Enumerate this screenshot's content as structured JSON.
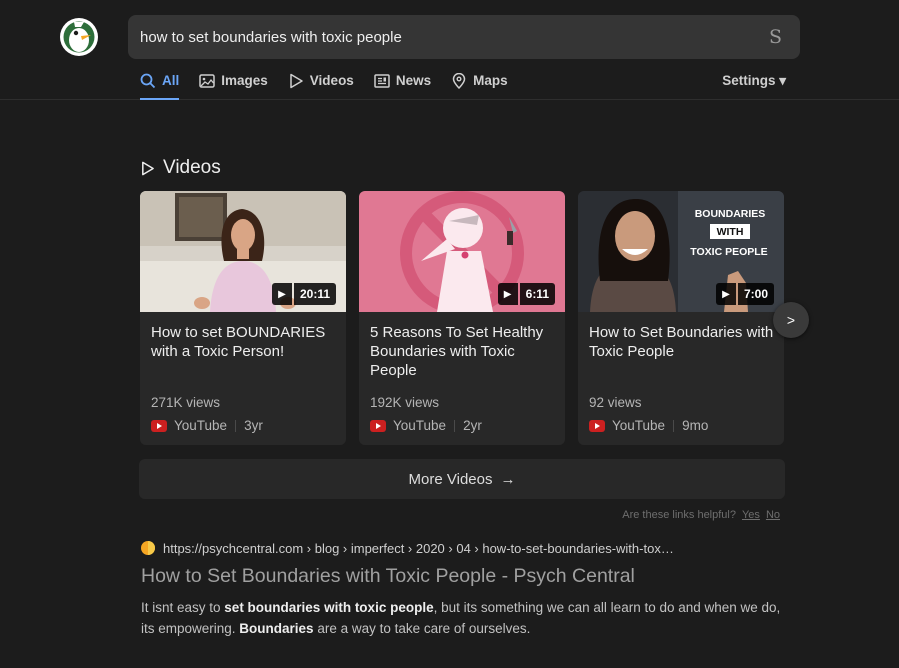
{
  "search": {
    "query": "how to set boundaries with toxic people",
    "button_glyph": "S"
  },
  "nav": {
    "items": [
      {
        "label": "All",
        "icon": "search-icon"
      },
      {
        "label": "Images",
        "icon": "image-icon"
      },
      {
        "label": "Videos",
        "icon": "play-icon"
      },
      {
        "label": "News",
        "icon": "newspaper-icon"
      },
      {
        "label": "Maps",
        "icon": "map-pin-icon"
      }
    ],
    "active": "All",
    "settings_label": "Settings ▾"
  },
  "videos": {
    "section_title": "Videos",
    "cards": [
      {
        "title": "How to set BOUNDARIES with a Toxic Person!",
        "duration": "20:11",
        "views": "271K views",
        "source": "YouTube",
        "age": "3yr"
      },
      {
        "title": "5 Reasons To Set Healthy Boundaries with Toxic People",
        "duration": "6:11",
        "views": "192K views",
        "source": "YouTube",
        "age": "2yr"
      },
      {
        "title": "How to Set Boundaries with Toxic People",
        "duration": "7:00",
        "views": "92 views",
        "source": "YouTube",
        "age": "9mo",
        "thumb_text_1": "BOUNDARIES",
        "thumb_text_2": "WITH",
        "thumb_text_3": "TOXIC PEOPLE"
      }
    ],
    "next_label": ">",
    "more_label": "More Videos",
    "more_arrow": "→"
  },
  "feedback": {
    "question": "Are these links helpful?",
    "yes": "Yes",
    "no": "No"
  },
  "result": {
    "url": "https://psychcentral.com › blog › imperfect › 2020 › 04 › how-to-set-boundaries-with-tox…",
    "title": "How to Set Boundaries with Toxic People - Psych Central",
    "snippet": {
      "p1": "It isnt easy to ",
      "b1": "set boundaries with toxic people",
      "p2": ", but its something we can all learn to do and when we do, its empowering. ",
      "b2": "Boundaries",
      "p3": " are a way to take care of ourselves."
    }
  },
  "colors": {
    "accent": "#6ba6f7",
    "background": "#1c1c1c",
    "card": "#282828",
    "youtube": "#cc2020"
  }
}
